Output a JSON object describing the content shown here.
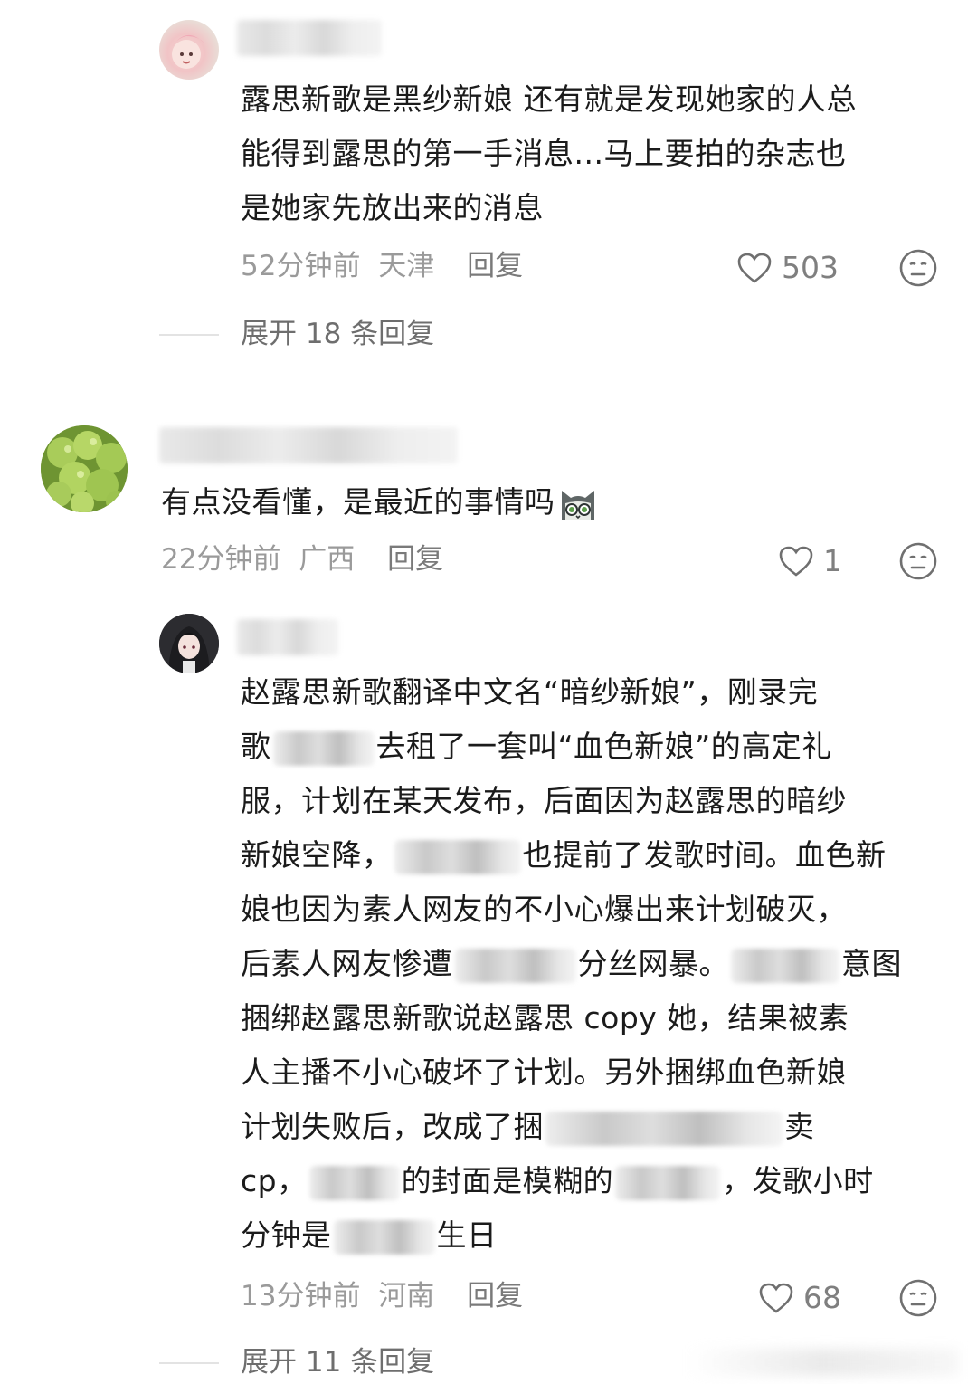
{
  "comments": [
    {
      "lines": [
        "露思新歌是黑纱新娘 还有就是发现她家的人总",
        "能得到露思的第一手消息...马上要拍的杂志也",
        "是她家先放出来的消息"
      ],
      "time": "52分钟前",
      "location": "天津",
      "reply_label": "回复",
      "likes": "503",
      "expand_label": "展开 18 条回复"
    },
    {
      "text": "有点没看懂，是最近的事情吗",
      "time": "22分钟前",
      "location": "广西",
      "reply_label": "回复",
      "likes": "1"
    },
    {
      "segments": {
        "l1": "赵露思新歌翻译中文名“暗纱新娘”，刚录完",
        "l2a": "歌",
        "l2b": "去租了一套叫“血色新娘”的高定礼",
        "l3": "服，计划在某天发布，后面因为赵露思的暗纱",
        "l4a": "新娘空降，",
        "l4b": "也提前了发歌时间。血色新",
        "l5": "娘也因为素人网友的不小心爆出来计划破灭，",
        "l6a": "后素人网友惨遭",
        "l6b": "分丝网暴。",
        "l6c": "意图",
        "l7": "捆绑赵露思新歌说赵露思 copy 她，结果被素",
        "l8": "人主播不小心破坏了计划。另外捆绑血色新娘",
        "l9a": "计划失败后，改成了捆",
        "l9b": "卖",
        "l10a": "cp，",
        "l10b": "的封面是模糊的",
        "l10c": "，发歌小时",
        "l11a": "分钟是",
        "l11b": "生日"
      },
      "time": "13分钟前",
      "location": "河南",
      "reply_label": "回复",
      "likes": "68",
      "expand_label": "展开 11 条回复"
    }
  ]
}
